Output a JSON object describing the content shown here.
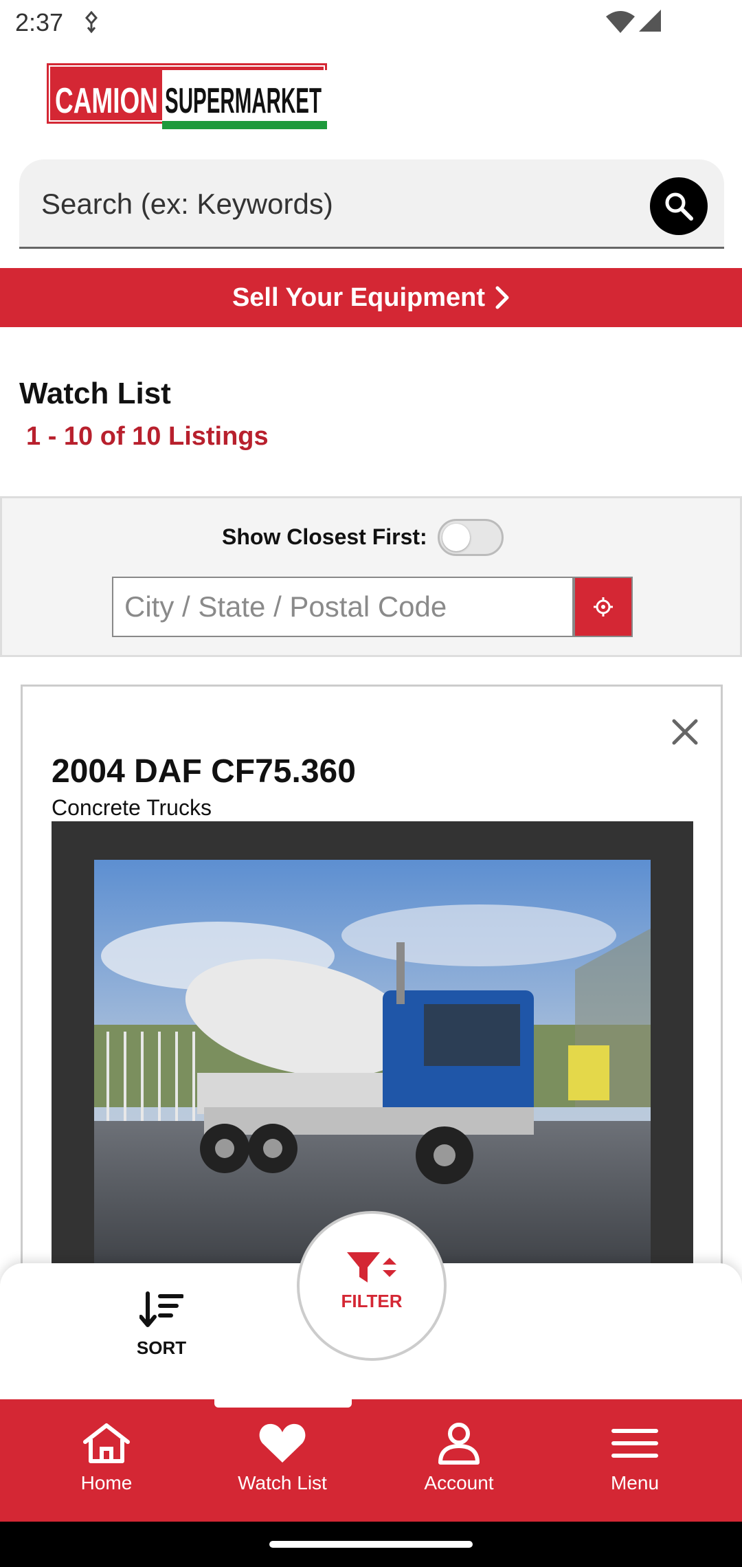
{
  "status_bar": {
    "time": "2:37"
  },
  "logo": {
    "text_part1": "CAMION",
    "text_part2": "SUPERMARKET"
  },
  "search": {
    "placeholder": "Search (ex: Keywords)"
  },
  "sell_banner": {
    "label": "Sell Your Equipment"
  },
  "watch_list": {
    "title": "Watch List",
    "count": "1 - 10 of 10 Listings"
  },
  "location": {
    "closest_label": "Show Closest First:",
    "closest_toggle_on": false,
    "placeholder": "City / State / Postal Code"
  },
  "listing": {
    "title": "2004 DAF CF75.360",
    "category": "Concrete Trucks"
  },
  "actions": {
    "sort_label": "SORT",
    "filter_label": "FILTER"
  },
  "bottom_nav": {
    "items": [
      {
        "label": "Home",
        "icon": "home-icon"
      },
      {
        "label": "Watch List",
        "icon": "heart-icon",
        "active": true
      },
      {
        "label": "Account",
        "icon": "account-icon"
      },
      {
        "label": "Menu",
        "icon": "menu-icon"
      }
    ]
  },
  "colors": {
    "brand_red": "#d42734",
    "count_red": "#b8202d",
    "logo_green": "#1e9a3c"
  }
}
